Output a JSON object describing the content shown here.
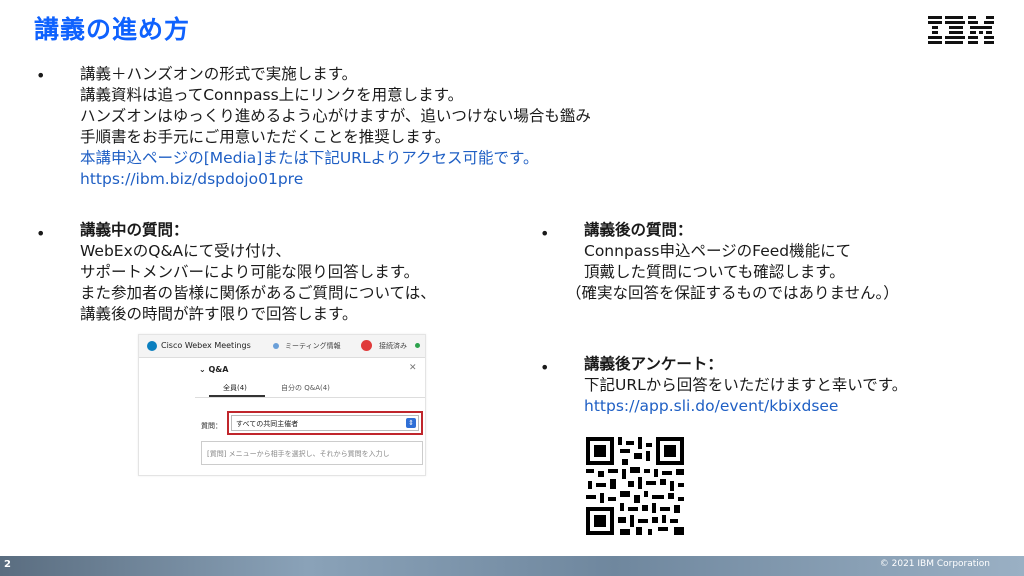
{
  "header": {
    "title": "講義の進め方",
    "logo_text": "IBM",
    "brand_color": "#0f62fe"
  },
  "bullet_char": "•",
  "intro": {
    "lines": [
      "講義＋ハンズオンの形式で実施します。",
      "講義資料は追ってConnpass上にリンクを用意します。",
      "ハンズオンはゆっくり進めるよう心がけますが、追いつけない場合も鑑み",
      "手順書をお手元にご用意いただくことを推奨します。"
    ],
    "link_lines": [
      "本講申込ページの[Media]または下記URLよりアクセス可能です。",
      "https://ibm.biz/dspdojo01pre"
    ]
  },
  "during": {
    "heading": "講義中の質問：",
    "lines": [
      "WebExのQ&Aにて受け付け、",
      "サポートメンバーにより可能な限り回答します。",
      "また参加者の皆様に関係があるご質問については、",
      "講義後の時間が許す限りで回答します。"
    ]
  },
  "after": {
    "heading": "講義後の質問：",
    "lines": [
      "Connpass申込ページのFeed機能にて",
      "頂戴した質問についても確認します。",
      "（確実な回答を保証するものではありません。）"
    ]
  },
  "survey": {
    "heading": "講義後アンケート：",
    "line": "下記URLから回答をいただけますと幸いです。",
    "url": "https://app.sli.do/event/kbixdsee"
  },
  "screenshot": {
    "app_title": "Cisco Webex Meetings",
    "meeting_label": "ミーティング情報",
    "connection_label": "接続済み",
    "panel_title": "Q&A",
    "tab_all": "全員(4)",
    "tab_mine": "自分の Q&A(4)",
    "question_label": "質問：",
    "recipient_value": "すべての共同主催者",
    "input_placeholder": "[質問] メニューから相手を選択し、それから質問を入力し"
  },
  "footer": {
    "page_number": "2",
    "copyright": "© 2021 IBM Corporation"
  }
}
